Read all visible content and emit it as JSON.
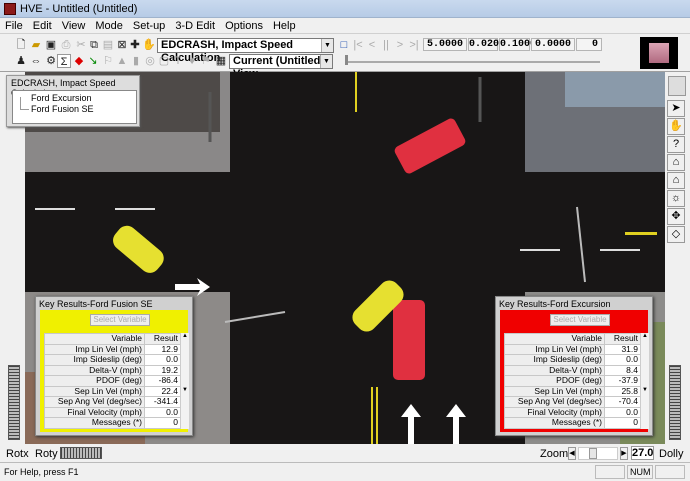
{
  "window": {
    "title": "HVE - Untitled (Untitled)"
  },
  "menu": [
    "File",
    "Edit",
    "View",
    "Mode",
    "Set-up",
    "3-D Edit",
    "Options",
    "Help"
  ],
  "toolbar": {
    "event_combo": "EDCRASH, Impact Speed Calculation",
    "view_combo": "Current (Untitled) View",
    "playback": {
      "stop": "□",
      "first": "|<",
      "prev": "<",
      "pause": "||",
      "next": ">",
      "last": ">|"
    },
    "readouts": [
      "5.0000",
      "0.0200",
      "0.1000",
      "0.0000",
      "0"
    ]
  },
  "tree": {
    "title": "EDCRASH, Impact Speed Calculation",
    "items": [
      "Ford Excursion",
      "Ford Fusion SE"
    ]
  },
  "panels": [
    {
      "title": "Key Results-Ford Fusion SE",
      "color": "#f0f000",
      "select_label": "Select Variable",
      "headers": [
        "Variable",
        "Result"
      ],
      "rows": [
        [
          "Imp Lin Vel (mph)",
          "12.9"
        ],
        [
          "Imp Sideslip (deg)",
          "0.0"
        ],
        [
          "Delta-V (mph)",
          "19.2"
        ],
        [
          "PDOF (deg)",
          "-86.4"
        ],
        [
          "Sep Lin Vel (mph)",
          "22.4"
        ],
        [
          "Sep Ang Vel (deg/sec)",
          "-341.4"
        ],
        [
          "Final Velocity (mph)",
          "0.0"
        ],
        [
          "Messages (*)",
          "0"
        ]
      ]
    },
    {
      "title": "Key Results-Ford Excursion",
      "color": "#f00000",
      "select_label": "Select Variable",
      "headers": [
        "Variable",
        "Result"
      ],
      "rows": [
        [
          "Imp Lin Vel (mph)",
          "31.9"
        ],
        [
          "Imp Sideslip (deg)",
          "0.0"
        ],
        [
          "Delta-V (mph)",
          "8.4"
        ],
        [
          "PDOF (deg)",
          "-37.9"
        ],
        [
          "Sep Lin Vel (mph)",
          "25.8"
        ],
        [
          "Sep Ang Vel (deg/sec)",
          "-70.4"
        ],
        [
          "Final Velocity (mph)",
          "0.0"
        ],
        [
          "Messages (*)",
          "0"
        ]
      ]
    }
  ],
  "right_tools": [
    "arrow-icon",
    "hand-icon",
    "help-icon",
    "home-icon",
    "home-zoom-icon",
    "lights-icon",
    "move-icon",
    "perspective-icon"
  ],
  "bottom": {
    "rotx": "Rotx",
    "roty": "Roty",
    "zoom": "Zoom",
    "zoom_value": "27.0",
    "dolly": "Dolly"
  },
  "status": {
    "help": "For Help, press F1",
    "num": "NUM"
  },
  "vehicles": {
    "fusion_color": "#e6e030",
    "excursion_color": "#e03040"
  }
}
